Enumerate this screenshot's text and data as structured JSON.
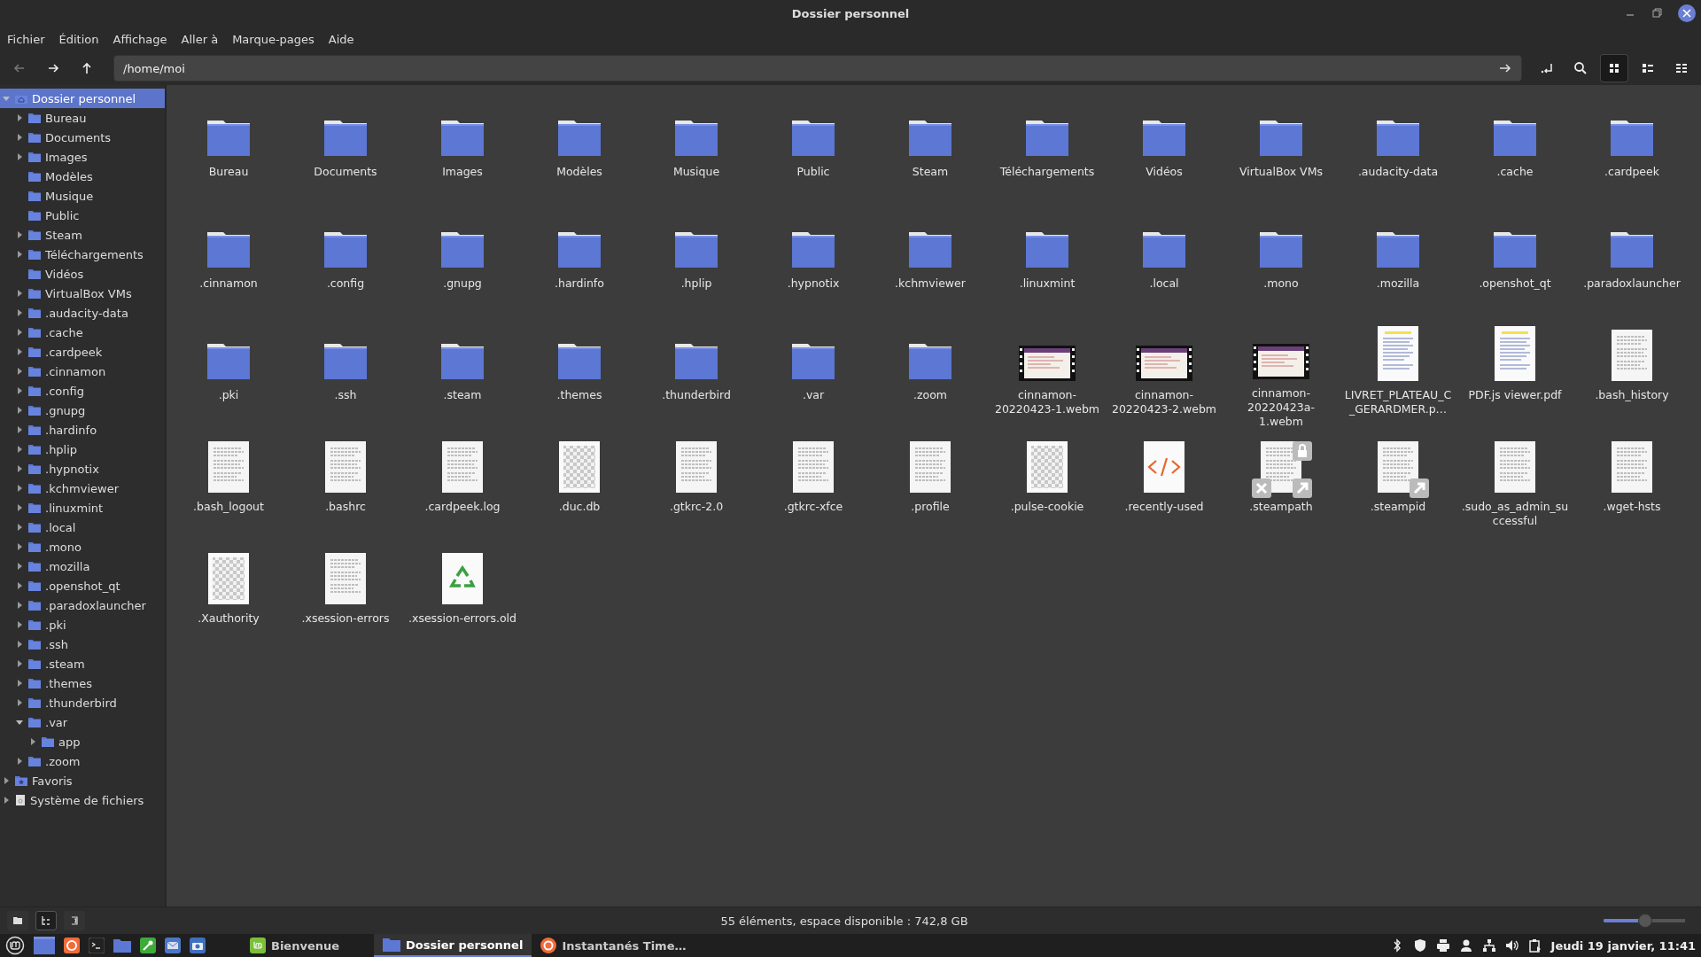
{
  "window": {
    "title": "Dossier personnel"
  },
  "menu": [
    "Fichier",
    "Édition",
    "Affichage",
    "Aller à",
    "Marque-pages",
    "Aide"
  ],
  "toolbar": {
    "back": {
      "disabled": true
    },
    "forward": {
      "disabled": false
    },
    "up": {
      "disabled": false
    },
    "location": "/home/moi",
    "view_buttons": [
      {
        "kind": "icons",
        "selected": true
      },
      {
        "kind": "list",
        "selected": false
      },
      {
        "kind": "compact",
        "selected": false
      }
    ]
  },
  "sidebar": {
    "items": [
      {
        "kind": "home",
        "label": "Dossier personnel",
        "selected": true,
        "expanded": true,
        "children": [
          {
            "label": "Bureau",
            "selected": false,
            "expanded": false
          },
          {
            "label": "Documents",
            "selected": false,
            "expanded": false
          },
          {
            "label": "Images",
            "selected": false,
            "expanded": false
          },
          {
            "label": "Modèles",
            "selected": false
          },
          {
            "label": "Musique",
            "selected": false
          },
          {
            "label": "Public",
            "selected": false
          },
          {
            "label": "Steam",
            "selected": false,
            "expanded": false
          },
          {
            "label": "Téléchargements",
            "selected": false,
            "expanded": false
          },
          {
            "label": "Vidéos",
            "selected": false
          },
          {
            "label": "VirtualBox VMs",
            "selected": false,
            "expanded": false
          },
          {
            "label": ".audacity-data",
            "selected": false,
            "expanded": false
          },
          {
            "label": ".cache",
            "selected": false,
            "expanded": false
          },
          {
            "label": ".cardpeek",
            "selected": false,
            "expanded": false
          },
          {
            "label": ".cinnamon",
            "selected": false,
            "expanded": false
          },
          {
            "label": ".config",
            "selected": false,
            "expanded": false
          },
          {
            "label": ".gnupg",
            "selected": false,
            "expanded": false
          },
          {
            "label": ".hardinfo",
            "selected": false,
            "expanded": false
          },
          {
            "label": ".hplip",
            "selected": false,
            "expanded": false
          },
          {
            "label": ".hypnotix",
            "selected": false,
            "expanded": false
          },
          {
            "label": ".kchmviewer",
            "selected": false,
            "expanded": false
          },
          {
            "label": ".linuxmint",
            "selected": false,
            "expanded": false
          },
          {
            "label": ".local",
            "selected": false,
            "expanded": false
          },
          {
            "label": ".mono",
            "selected": false,
            "expanded": false
          },
          {
            "label": ".mozilla",
            "selected": false,
            "expanded": false
          },
          {
            "label": ".openshot_qt",
            "selected": false,
            "expanded": false
          },
          {
            "label": ".paradoxlauncher",
            "selected": false,
            "expanded": false
          },
          {
            "label": ".pki",
            "selected": false,
            "expanded": false
          },
          {
            "label": ".ssh",
            "selected": false,
            "expanded": false
          },
          {
            "label": ".steam",
            "selected": false,
            "expanded": false
          },
          {
            "label": ".themes",
            "selected": false,
            "expanded": false
          },
          {
            "label": ".thunderbird",
            "selected": false,
            "expanded": false
          },
          {
            "label": ".var",
            "selected": false,
            "expanded": true,
            "children": [
              {
                "label": "app",
                "selected": false,
                "expanded": false
              }
            ]
          },
          {
            "label": ".zoom",
            "selected": false,
            "expanded": false
          }
        ]
      },
      {
        "kind": "favorites",
        "label": "Favoris",
        "selected": false,
        "expanded": false
      },
      {
        "kind": "drive",
        "label": "Système de fichiers",
        "selected": false,
        "expanded": false
      }
    ]
  },
  "files": [
    {
      "name": "Bureau",
      "kind": "folder"
    },
    {
      "name": "Documents",
      "kind": "folder"
    },
    {
      "name": "Images",
      "kind": "folder"
    },
    {
      "name": "Modèles",
      "kind": "folder"
    },
    {
      "name": "Musique",
      "kind": "folder"
    },
    {
      "name": "Public",
      "kind": "folder"
    },
    {
      "name": "Steam",
      "kind": "folder"
    },
    {
      "name": "Téléchargements",
      "kind": "folder"
    },
    {
      "name": "Vidéos",
      "kind": "folder"
    },
    {
      "name": "VirtualBox VMs",
      "kind": "folder"
    },
    {
      "name": ".audacity-data",
      "kind": "folder"
    },
    {
      "name": ".cache",
      "kind": "folder"
    },
    {
      "name": ".cardpeek",
      "kind": "folder"
    },
    {
      "name": ".cinnamon",
      "kind": "folder"
    },
    {
      "name": ".config",
      "kind": "folder"
    },
    {
      "name": ".gnupg",
      "kind": "folder"
    },
    {
      "name": ".hardinfo",
      "kind": "folder"
    },
    {
      "name": ".hplip",
      "kind": "folder"
    },
    {
      "name": ".hypnotix",
      "kind": "folder"
    },
    {
      "name": ".kchmviewer",
      "kind": "folder"
    },
    {
      "name": ".linuxmint",
      "kind": "folder"
    },
    {
      "name": ".local",
      "kind": "folder"
    },
    {
      "name": ".mono",
      "kind": "folder"
    },
    {
      "name": ".mozilla",
      "kind": "folder"
    },
    {
      "name": ".openshot_qt",
      "kind": "folder"
    },
    {
      "name": ".paradoxlauncher",
      "kind": "folder"
    },
    {
      "name": ".pki",
      "kind": "folder"
    },
    {
      "name": ".ssh",
      "kind": "folder"
    },
    {
      "name": ".steam",
      "kind": "folder"
    },
    {
      "name": ".themes",
      "kind": "folder"
    },
    {
      "name": ".thunderbird",
      "kind": "folder"
    },
    {
      "name": ".var",
      "kind": "folder"
    },
    {
      "name": ".zoom",
      "kind": "folder"
    },
    {
      "name": "cinnamon-20220423-1.webm",
      "kind": "video"
    },
    {
      "name": "cinnamon-20220423-2.webm",
      "kind": "video"
    },
    {
      "name": "cinnamon-20220423a-1.webm",
      "kind": "video"
    },
    {
      "name": "LIVRET_PLATEAU_C_GERARDMER.p…",
      "kind": "pdf"
    },
    {
      "name": "PDF.js viewer.pdf",
      "kind": "pdf"
    },
    {
      "name": ".bash_history",
      "kind": "text"
    },
    {
      "name": ".bash_logout",
      "kind": "text"
    },
    {
      "name": ".bashrc",
      "kind": "text"
    },
    {
      "name": ".cardpeek.log",
      "kind": "text"
    },
    {
      "name": ".duc.db",
      "kind": "blank"
    },
    {
      "name": ".gtkrc-2.0",
      "kind": "text"
    },
    {
      "name": ".gtkrc-xfce",
      "kind": "text"
    },
    {
      "name": ".profile",
      "kind": "text"
    },
    {
      "name": ".pulse-cookie",
      "kind": "blank"
    },
    {
      "name": ".recently-used",
      "kind": "code"
    },
    {
      "name": ".steampath",
      "kind": "brokenlink"
    },
    {
      "name": ".steampid",
      "kind": "symlink"
    },
    {
      "name": ".sudo_as_admin_successful",
      "kind": "text"
    },
    {
      "name": ".wget-hsts",
      "kind": "text"
    },
    {
      "name": ".Xauthority",
      "kind": "blank"
    },
    {
      "name": ".xsession-errors",
      "kind": "text"
    },
    {
      "name": ".xsession-errors.old",
      "kind": "recycle"
    }
  ],
  "status_bar": {
    "buttons": [
      {
        "kind": "places",
        "selected": false
      },
      {
        "kind": "tree",
        "selected": true
      },
      {
        "kind": "hide",
        "selected": false
      }
    ],
    "text": "55 éléments, espace disponible : 742,8 GB",
    "zoom": {
      "level": 0.5
    }
  },
  "taskbar": {
    "windows": [
      {
        "kind": "mint",
        "label": "Bienvenue",
        "selected": false
      },
      {
        "kind": "folder",
        "label": "Dossier personnel",
        "selected": true
      },
      {
        "kind": "firefox",
        "label": "Instantanés Time…",
        "selected": false
      }
    ],
    "clock": "Jeudi 19 janvier, 11:41"
  }
}
